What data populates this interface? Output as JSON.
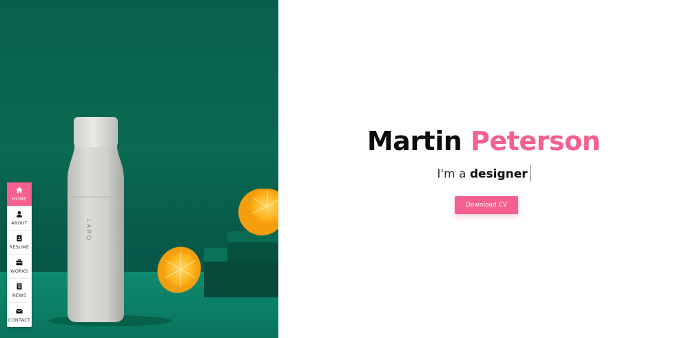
{
  "nav": {
    "items": [
      {
        "label": "HOME",
        "icon": "home-icon"
      },
      {
        "label": "ABOUT",
        "icon": "user-icon"
      },
      {
        "label": "RESUME",
        "icon": "resume-icon"
      },
      {
        "label": "WORKS",
        "icon": "briefcase-icon"
      },
      {
        "label": "NEWS",
        "icon": "news-icon"
      },
      {
        "label": "CONTACT",
        "icon": "envelope-icon"
      }
    ],
    "active_index": 0
  },
  "hero": {
    "brand_on_bottle": "LARQ"
  },
  "intro": {
    "first_name": "Martin",
    "last_name": "Peterson",
    "role_prefix": "I'm a",
    "role_word": "designer",
    "cta_label": "Download CV"
  },
  "colors": {
    "accent": "#f6608e",
    "hero_bg": "#08604a",
    "text": "#0c0c0c"
  }
}
